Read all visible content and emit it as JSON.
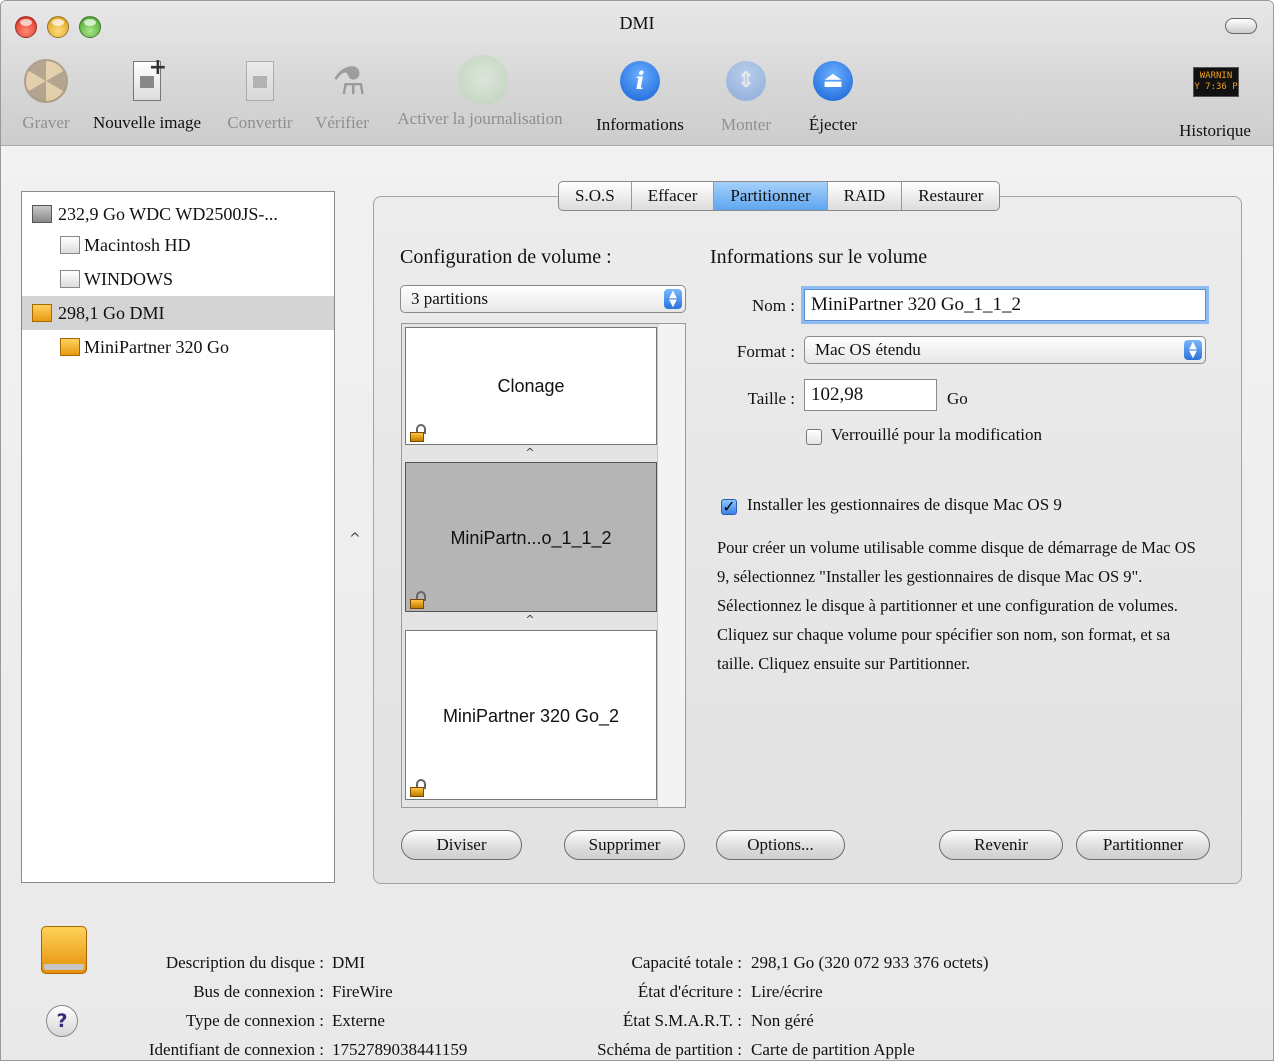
{
  "window": {
    "title": "DMI"
  },
  "toolbar": {
    "items": [
      {
        "label": "Graver",
        "icon": "burn-icon",
        "enabled": false
      },
      {
        "label": "Nouvelle image",
        "icon": "new-image-icon",
        "enabled": true
      },
      {
        "label": "Convertir",
        "icon": "convert-icon",
        "enabled": false
      },
      {
        "label": "Vérifier",
        "icon": "microscope-icon",
        "enabled": false
      },
      {
        "label": "Activer la journalisation",
        "icon": "journaling-icon",
        "enabled": false
      },
      {
        "label": "Informations",
        "icon": "info-icon",
        "enabled": true
      },
      {
        "label": "Monter",
        "icon": "mount-icon",
        "enabled": false
      },
      {
        "label": "Éjecter",
        "icon": "eject-icon",
        "enabled": true
      },
      {
        "label": "Historique",
        "icon": "log-icon",
        "enabled": true
      }
    ],
    "log_icon_text": [
      "WARNIN",
      "Y 7:36 P"
    ]
  },
  "sidebar": {
    "items": [
      {
        "label": "232,9 Go WDC WD2500JS-...",
        "icon": "hard-disk-icon",
        "level": 0,
        "selected": false
      },
      {
        "label": "Macintosh HD",
        "icon": "volume-icon",
        "level": 1,
        "selected": false
      },
      {
        "label": "WINDOWS",
        "icon": "volume-icon",
        "level": 1,
        "selected": false
      },
      {
        "label": "298,1 Go DMI",
        "icon": "external-disk-icon",
        "level": 0,
        "selected": true
      },
      {
        "label": "MiniPartner 320 Go",
        "icon": "external-disk-icon",
        "level": 1,
        "selected": false
      }
    ]
  },
  "tabs": [
    {
      "label": "S.O.S",
      "active": false
    },
    {
      "label": "Effacer",
      "active": false
    },
    {
      "label": "Partitionner",
      "active": true
    },
    {
      "label": "RAID",
      "active": false
    },
    {
      "label": "Restaurer",
      "active": false
    }
  ],
  "partition": {
    "config_title": "Configuration de volume :",
    "config_value": "3 partitions",
    "partitions": [
      {
        "name": "Clonage",
        "selected": false
      },
      {
        "name": "MiniPartn...o_1_1_2",
        "selected": true
      },
      {
        "name": "MiniPartner 320 Go_2",
        "selected": false
      }
    ],
    "handle_glyph": "^"
  },
  "volume_info": {
    "title": "Informations sur le volume",
    "name_label": "Nom :",
    "name_value": "MiniPartner 320 Go_1_1_2",
    "format_label": "Format :",
    "format_value": "Mac OS étendu",
    "size_label": "Taille :",
    "size_value": "102,98",
    "size_unit": "Go",
    "locked_label": "Verrouillé pour la modification",
    "locked_checked": false,
    "os9_label": "Installer les gestionnaires de disque Mac OS 9",
    "os9_checked": true,
    "help_text_1": "Pour créer un volume utilisable comme disque de démarrage de Mac OS 9, sélectionnez \"Installer les gestionnaires de disque Mac OS 9\".",
    "help_text_2": "Sélectionnez le disque à partitionner et une configuration de volumes. Cliquez sur chaque volume pour spécifier son nom, son format, et sa taille. Cliquez ensuite sur Partitionner."
  },
  "buttons": {
    "split": "Diviser",
    "delete": "Supprimer",
    "options": "Options...",
    "revert": "Revenir",
    "partition": "Partitionner"
  },
  "disk_info": {
    "left": [
      {
        "label": "Description du disque :",
        "value": "DMI"
      },
      {
        "label": "Bus de connexion :",
        "value": "FireWire"
      },
      {
        "label": "Type de connexion :",
        "value": "Externe"
      },
      {
        "label": "Identifiant de connexion :",
        "value": "1752789038441159"
      }
    ],
    "right": [
      {
        "label": "Capacité totale :",
        "value": "298,1 Go (320 072 933 376 octets)"
      },
      {
        "label": "État d'écriture :",
        "value": "Lire/écrire"
      },
      {
        "label": "État S.M.A.R.T. :",
        "value": "Non géré"
      },
      {
        "label": "Schéma de partition :",
        "value": "Carte de partition Apple"
      }
    ],
    "help_glyph": "?"
  },
  "colors": {
    "accent": "#5ea6ef",
    "selection": "#d4d4d4",
    "partition_selected": "#b5b5b5"
  }
}
